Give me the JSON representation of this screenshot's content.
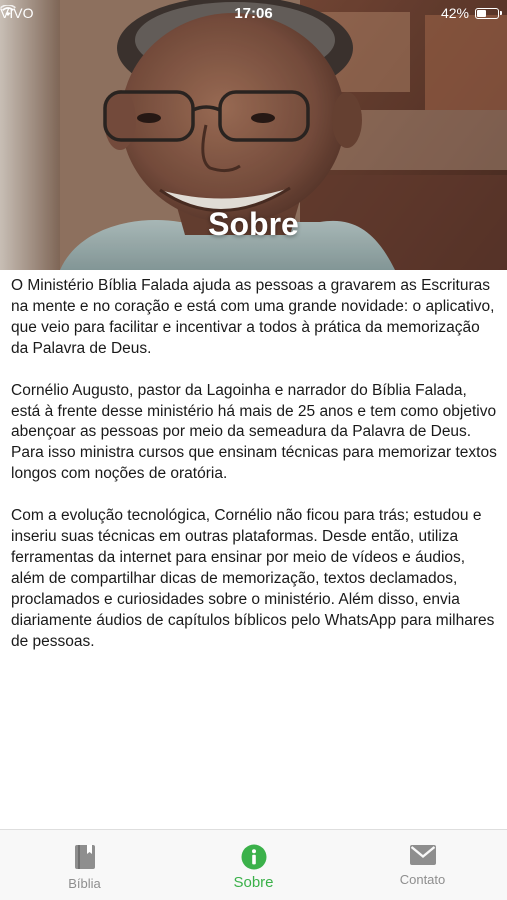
{
  "status_bar": {
    "carrier": "VIVO",
    "time": "17:06",
    "battery": "42%",
    "battery_level": 0.42
  },
  "header": {
    "title": "Sobre"
  },
  "content": {
    "paragraphs": [
      "O Ministério Bíblia Falada ajuda as pessoas a gravarem as Escrituras na mente e no coração e está com uma grande novidade: o aplicativo, que veio para facilitar e incentivar a todos à prática da memorização da Palavra de Deus.",
      "Cornélio Augusto, pastor da Lagoinha e narrador do Bíblia Falada, está à frente desse ministério há mais de 25 anos e tem como objetivo abençoar as pessoas por meio da semeadura da Palavra de Deus. Para isso ministra cursos que ensinam técnicas para memorizar textos longos com noções de oratória.",
      "Com a evolução tecnológica, Cornélio não ficou para trás; estudou e inseriu suas técnicas em outras plataformas. Desde então, utiliza ferramentas da internet para ensinar por meio de vídeos e áudios, além de compartilhar dicas de memorização, textos declamados, proclamados e curiosidades sobre o ministério. Além disso, envia diariamente áudios de capítulos bíblicos pelo WhatsApp para milhares de pessoas."
    ]
  },
  "tab_bar": {
    "active_color": "#3bb14a",
    "inactive_color": "#8e8e8e",
    "tabs": [
      {
        "label": "Bíblia",
        "icon": "book-icon",
        "active": false
      },
      {
        "label": "Sobre",
        "icon": "info-icon",
        "active": true
      },
      {
        "label": "Contato",
        "icon": "mail-icon",
        "active": false
      }
    ]
  }
}
